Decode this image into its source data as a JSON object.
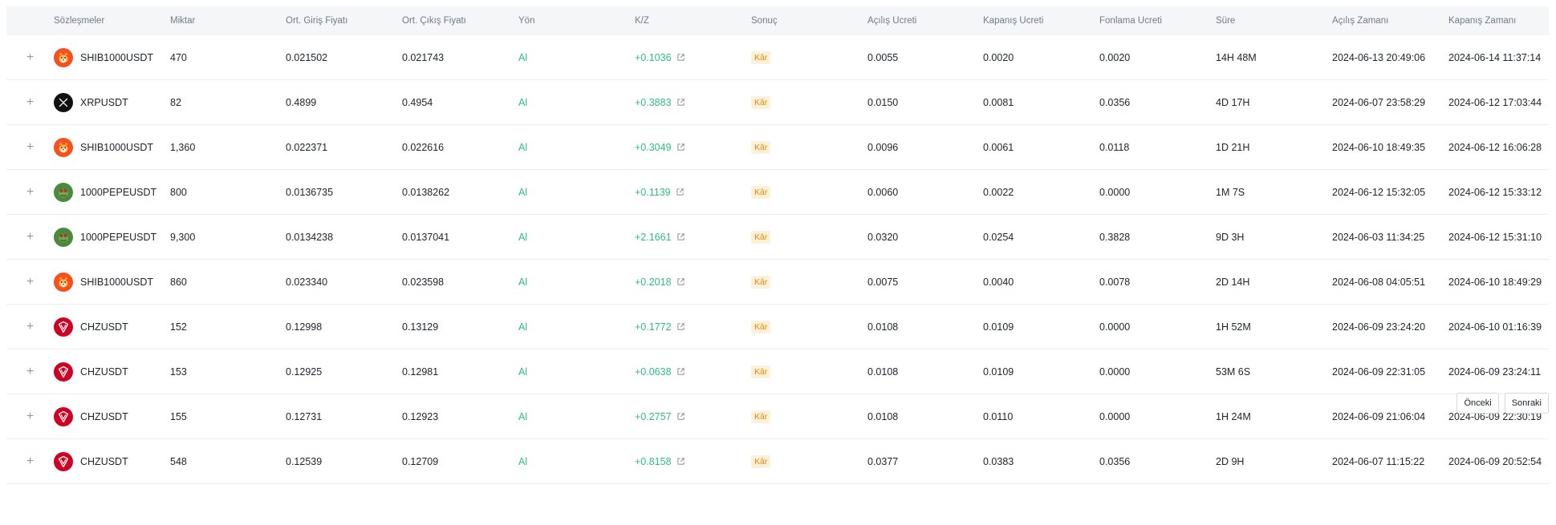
{
  "columns": {
    "contract": "Sözleşmeler",
    "qty": "Miktar",
    "entry": "Ort. Giriş Fiyatı",
    "exit": "Ort. Çıkış Fiyatı",
    "direction": "Yön",
    "pnl": "K/Z",
    "result": "Sonuç",
    "open_fee": "Açılış Ücreti",
    "close_fee": "Kapanış Ücreti",
    "funding_fee": "Fonlama Ücreti",
    "duration": "Süre",
    "open_time": "Açılış Zamanı",
    "close_time": "Kapanış Zamanı"
  },
  "expand_symbol": "+",
  "icons": {
    "shib": "shiba-inu-coin-icon",
    "xrp": "xrp-coin-icon",
    "pepe": "pepe-coin-icon",
    "chz": "chiliz-coin-icon",
    "external": "external-link-icon"
  },
  "colors": {
    "profit": "#2ebd85",
    "badge_text": "#e38a00",
    "badge_bg": "#fdf1dc",
    "shib": "#f4511e",
    "xrp": "#111111",
    "pepe": "#4a8a3c",
    "chz": "#cd0124"
  },
  "rows": [
    {
      "coin": "shib",
      "contract": "SHIB1000USDT",
      "qty": "470",
      "entry": "0.021502",
      "exit": "0.021743",
      "direction": "Al",
      "pnl": "+0.1036",
      "result": "Kâr",
      "open_fee": "0.0055",
      "close_fee": "0.0020",
      "funding_fee": "0.0020",
      "duration": "14H 48M",
      "open_time": "2024-06-13 20:49:06",
      "close_time": "2024-06-14 11:37:14"
    },
    {
      "coin": "xrp",
      "contract": "XRPUSDT",
      "qty": "82",
      "entry": "0.4899",
      "exit": "0.4954",
      "direction": "Al",
      "pnl": "+0.3883",
      "result": "Kâr",
      "open_fee": "0.0150",
      "close_fee": "0.0081",
      "funding_fee": "0.0356",
      "duration": "4D 17H",
      "open_time": "2024-06-07 23:58:29",
      "close_time": "2024-06-12 17:03:44"
    },
    {
      "coin": "shib",
      "contract": "SHIB1000USDT",
      "qty": "1,360",
      "entry": "0.022371",
      "exit": "0.022616",
      "direction": "Al",
      "pnl": "+0.3049",
      "result": "Kâr",
      "open_fee": "0.0096",
      "close_fee": "0.0061",
      "funding_fee": "0.0118",
      "duration": "1D 21H",
      "open_time": "2024-06-10 18:49:35",
      "close_time": "2024-06-12 16:06:28"
    },
    {
      "coin": "pepe",
      "contract": "1000PEPEUSDT",
      "qty": "800",
      "entry": "0.0136735",
      "exit": "0.0138262",
      "direction": "Al",
      "pnl": "+0.1139",
      "result": "Kâr",
      "open_fee": "0.0060",
      "close_fee": "0.0022",
      "funding_fee": "0.0000",
      "duration": "1M 7S",
      "open_time": "2024-06-12 15:32:05",
      "close_time": "2024-06-12 15:33:12"
    },
    {
      "coin": "pepe",
      "contract": "1000PEPEUSDT",
      "qty": "9,300",
      "entry": "0.0134238",
      "exit": "0.0137041",
      "direction": "Al",
      "pnl": "+2.1661",
      "result": "Kâr",
      "open_fee": "0.0320",
      "close_fee": "0.0254",
      "funding_fee": "0.3828",
      "duration": "9D 3H",
      "open_time": "2024-06-03 11:34:25",
      "close_time": "2024-06-12 15:31:10"
    },
    {
      "coin": "shib",
      "contract": "SHIB1000USDT",
      "qty": "860",
      "entry": "0.023340",
      "exit": "0.023598",
      "direction": "Al",
      "pnl": "+0.2018",
      "result": "Kâr",
      "open_fee": "0.0075",
      "close_fee": "0.0040",
      "funding_fee": "0.0078",
      "duration": "2D 14H",
      "open_time": "2024-06-08 04:05:51",
      "close_time": "2024-06-10 18:49:29"
    },
    {
      "coin": "chz",
      "contract": "CHZUSDT",
      "qty": "152",
      "entry": "0.12998",
      "exit": "0.13129",
      "direction": "Al",
      "pnl": "+0.1772",
      "result": "Kâr",
      "open_fee": "0.0108",
      "close_fee": "0.0109",
      "funding_fee": "0.0000",
      "duration": "1H 52M",
      "open_time": "2024-06-09 23:24:20",
      "close_time": "2024-06-10 01:16:39"
    },
    {
      "coin": "chz",
      "contract": "CHZUSDT",
      "qty": "153",
      "entry": "0.12925",
      "exit": "0.12981",
      "direction": "Al",
      "pnl": "+0.0638",
      "result": "Kâr",
      "open_fee": "0.0108",
      "close_fee": "0.0109",
      "funding_fee": "0.0000",
      "duration": "53M 6S",
      "open_time": "2024-06-09 22:31:05",
      "close_time": "2024-06-09 23:24:11"
    },
    {
      "coin": "chz",
      "contract": "CHZUSDT",
      "qty": "155",
      "entry": "0.12731",
      "exit": "0.12923",
      "direction": "Al",
      "pnl": "+0.2757",
      "result": "Kâr",
      "open_fee": "0.0108",
      "close_fee": "0.0110",
      "funding_fee": "0.0000",
      "duration": "1H 24M",
      "open_time": "2024-06-09 21:06:04",
      "close_time": "2024-06-09 22:30:19"
    },
    {
      "coin": "chz",
      "contract": "CHZUSDT",
      "qty": "548",
      "entry": "0.12539",
      "exit": "0.12709",
      "direction": "Al",
      "pnl": "+0.8158",
      "result": "Kâr",
      "open_fee": "0.0377",
      "close_fee": "0.0383",
      "funding_fee": "0.0356",
      "duration": "2D 9H",
      "open_time": "2024-06-07 11:15:22",
      "close_time": "2024-06-09 20:52:54"
    }
  ],
  "pagination": {
    "prev_label": "Önceki",
    "next_label": "Sonraki"
  }
}
